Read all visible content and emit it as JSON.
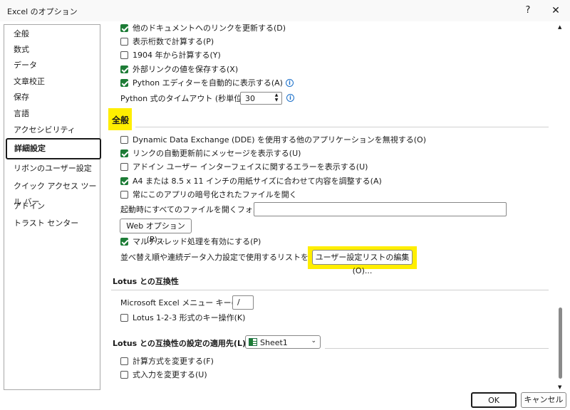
{
  "window": {
    "title": "Excel のオプション",
    "help": "?",
    "close": "✕"
  },
  "sidebar": {
    "items": [
      {
        "label": "全般"
      },
      {
        "label": "数式"
      },
      {
        "label": "データ"
      },
      {
        "label": "文章校正"
      },
      {
        "label": "保存"
      },
      {
        "label": "言語"
      },
      {
        "label": "アクセシビリティ"
      },
      {
        "label": "詳細設定",
        "selected": true
      },
      {
        "label": "リボンのユーザー設定"
      },
      {
        "label": "クイック アクセス ツール バー"
      },
      {
        "label": "アドイン"
      },
      {
        "label": "トラスト センター"
      }
    ]
  },
  "options_top": [
    {
      "label": "他のドキュメントへのリンクを更新する(D)",
      "checked": true
    },
    {
      "label": "表示桁数で計算する(P)",
      "checked": false
    },
    {
      "label": "1904 年から計算する(Y)",
      "checked": false
    },
    {
      "label": "外部リンクの値を保存する(X)",
      "checked": true
    },
    {
      "label": "Python エディターを自動的に表示する(A)",
      "checked": true
    }
  ],
  "python_timeout": {
    "label": "Python 式のタイムアウト (秒単位)(P)",
    "value": "30"
  },
  "general": {
    "heading": "全般",
    "options": [
      {
        "label": "Dynamic Data Exchange (DDE) を使用する他のアプリケーションを無視する(O)",
        "checked": false
      },
      {
        "label": "リンクの自動更新前にメッセージを表示する(U)",
        "checked": true
      },
      {
        "label": "アドイン ユーザー インターフェイスに関するエラーを表示する(U)",
        "checked": false
      },
      {
        "label": "A4 または 8.5 x 11 インチの用紙サイズに合わせて内容を調整する(A)",
        "checked": true
      },
      {
        "label": "常にこのアプリの暗号化されたファイルを開く",
        "checked": false
      }
    ],
    "startup_folder_label": "起動時にすべてのファイルを開くフォルダー(L):",
    "startup_folder_value": "",
    "web_options_button": "Web オプション(P)...",
    "multithread": {
      "label": "マルチスレッド処理を有効にする(P)",
      "checked": true
    },
    "custom_list_label": "並べ替え順や連続データ入力設定で使用するリストを作成します:",
    "custom_list_button": "ユーザー設定リストの編集(O)..."
  },
  "lotus": {
    "heading": "Lotus との互換性",
    "menu_key_label": "Microsoft Excel メニュー キー(M):",
    "menu_key_value": "/",
    "nav_keys": {
      "label": "Lotus 1-2-3 形式のキー操作(K)",
      "checked": false
    }
  },
  "lotus_apply": {
    "heading": "Lotus との互換性の設定の適用先(L):",
    "sheet": "Sheet1",
    "options": [
      {
        "label": "計算方式を変更する(F)",
        "checked": false
      },
      {
        "label": "式入力を変更する(U)",
        "checked": false
      }
    ]
  },
  "footer": {
    "ok": "OK",
    "cancel": "キャンセル"
  },
  "colors": {
    "accent_green": "#1d7c36",
    "highlight_yellow": "#ffee00",
    "info_blue": "#1a6fc9"
  }
}
